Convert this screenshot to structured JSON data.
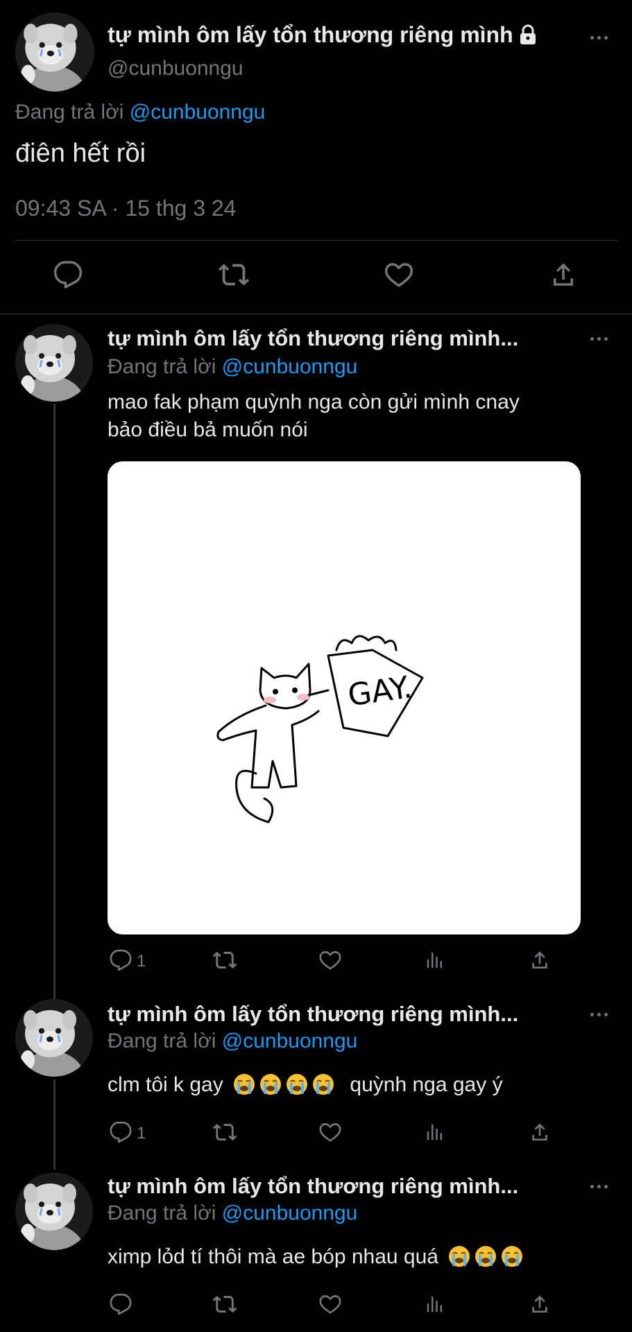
{
  "main_tweet": {
    "display_name": "tự mình ôm lấy tổn thương riêng mình",
    "handle": "@cunbuonngu",
    "replying_prefix": "Đang trả lời",
    "replying_handle": "@cunbuonngu",
    "text": "điên hết rồi",
    "timestamp": "09:43 SA · 15 thg 3 24"
  },
  "replies": [
    {
      "display_name": "tự mình ôm lấy tổn thương riêng mình...",
      "replying_prefix": "Đang trả lời",
      "replying_handle": "@cunbuonngu",
      "text_line1": "mao fak phạm quỳnh nga còn gửi mình cnay",
      "text_line2": "bảo điều bả muốn nói",
      "image_text": "GAY.",
      "reply_count": "1"
    },
    {
      "display_name": "tự mình ôm lấy tổn thương riêng mình...",
      "replying_prefix": "Đang trả lời",
      "replying_handle": "@cunbuonngu",
      "text_before": "clm tôi k gay",
      "text_after": "quỳnh nga gay ý",
      "emoji_count": 4,
      "emoji": "loudly-crying-face",
      "reply_count": "1"
    },
    {
      "display_name": "tự mình ôm lấy tổn thương riêng mình...",
      "replying_prefix": "Đang trả lời",
      "replying_handle": "@cunbuonngu",
      "text_before": "ximp lỏd tí thôi mà ae bóp nhau quá",
      "emoji_count": 3,
      "emoji": "loudly-crying-face",
      "reply_count": ""
    }
  ],
  "colors": {
    "background": "#000000",
    "text": "#e7e9ea",
    "secondary": "#71767b",
    "link": "#1d9bf0",
    "divider": "#2f3336"
  },
  "icons": [
    "reply-icon",
    "retweet-icon",
    "like-icon",
    "views-icon",
    "share-icon",
    "more-icon",
    "lock-icon"
  ]
}
